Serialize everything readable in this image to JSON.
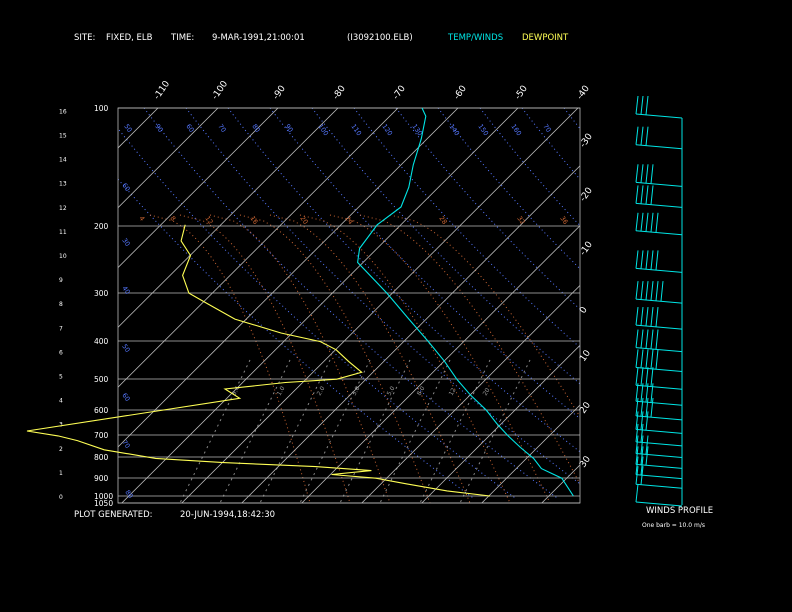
{
  "header": {
    "site_label": "SITE:",
    "site_value": "FIXED, ELB",
    "time_label": "TIME:",
    "time_value": "9-MAR-1991,21:00:01",
    "file_name": "(I3092100.ELB)",
    "legend_temp": "TEMP/WINDS",
    "legend_dew": "DEWPOINT"
  },
  "footer": {
    "generated_label": "PLOT GENERATED:",
    "generated_value": "20-JUN-1994,18:42:30",
    "winds_title": "WINDS PROFILE",
    "barb_note": "One barb = 10.0 m/s"
  },
  "colors": {
    "background": "#000000",
    "temp": "#00e5e5",
    "dew": "#ffff55",
    "grid": "#bbbbbb",
    "dry_adiabat": "#5577ff",
    "moist_adiabat": "#cc6633",
    "text": "#ffffff"
  },
  "chart_data": {
    "type": "line",
    "pressure_levels": [
      100,
      200,
      300,
      400,
      500,
      600,
      700,
      800,
      900,
      1000,
      1050
    ],
    "altitude_ticks_km": [
      0,
      1,
      2,
      3,
      4,
      5,
      6,
      7,
      8,
      9,
      10,
      11,
      12,
      13,
      14,
      15,
      16
    ],
    "isotherm_labels": [
      -110,
      -100,
      -90,
      -80,
      -70,
      -60,
      -50,
      -40,
      -30,
      -20,
      -10,
      0,
      10,
      20,
      30
    ],
    "dry_adiabat_labels": [
      "50",
      "90",
      "60",
      "70",
      "80",
      "90",
      "100",
      "110",
      "120",
      "130",
      "140",
      "150",
      "160",
      "70",
      "60",
      "30",
      "40",
      "50",
      "60",
      "70",
      "80",
      "90",
      "100"
    ],
    "moist_adiabat_labels": [
      "4",
      "8",
      "12",
      "16",
      "20",
      "24",
      "28",
      "32",
      "36"
    ],
    "mixing_ratio_labels": [
      "0.4",
      "1.0",
      "2.0",
      "3.0",
      "5.0",
      "8.0",
      "12",
      "20"
    ],
    "series": [
      {
        "name": "TEMP/WINDS",
        "points": [
          [
            1000,
            23.9
          ],
          [
            960,
            22
          ],
          [
            900,
            19
          ],
          [
            850,
            14
          ],
          [
            800,
            11
          ],
          [
            750,
            7
          ],
          [
            700,
            3
          ],
          [
            650,
            -1
          ],
          [
            600,
            -5
          ],
          [
            550,
            -10
          ],
          [
            500,
            -15
          ],
          [
            450,
            -20
          ],
          [
            400,
            -26
          ],
          [
            350,
            -33
          ],
          [
            300,
            -41
          ],
          [
            250,
            -51
          ],
          [
            230,
            -53
          ],
          [
            200,
            -54
          ],
          [
            180,
            -53
          ],
          [
            160,
            -55
          ],
          [
            140,
            -58
          ],
          [
            120,
            -61
          ],
          [
            105,
            -64
          ],
          [
            100,
            -66
          ]
        ]
      },
      {
        "name": "DEWPOINT",
        "points": [
          [
            1000,
            10
          ],
          [
            970,
            2
          ],
          [
            930,
            -6
          ],
          [
            900,
            -12
          ],
          [
            880,
            -20
          ],
          [
            860,
            -14
          ],
          [
            840,
            -24
          ],
          [
            820,
            -40
          ],
          [
            800,
            -52
          ],
          [
            760,
            -62
          ],
          [
            720,
            -68
          ],
          [
            700,
            -72
          ],
          [
            680,
            -78
          ],
          [
            560,
            -48
          ],
          [
            530,
            -52
          ],
          [
            510,
            -43
          ],
          [
            500,
            -35
          ],
          [
            480,
            -32
          ],
          [
            450,
            -36
          ],
          [
            420,
            -40
          ],
          [
            400,
            -44
          ],
          [
            380,
            -52
          ],
          [
            350,
            -62
          ],
          [
            320,
            -69
          ],
          [
            300,
            -74
          ],
          [
            270,
            -78
          ],
          [
            240,
            -80
          ],
          [
            220,
            -84
          ],
          [
            200,
            -86
          ]
        ]
      }
    ],
    "winds": [
      {
        "p": 1000,
        "dir": 180,
        "spd": 5
      },
      {
        "p": 900,
        "dir": 220,
        "spd": 15
      },
      {
        "p": 850,
        "dir": 240,
        "spd": 22
      },
      {
        "p": 800,
        "dir": 250,
        "spd": 25
      },
      {
        "p": 750,
        "dir": 260,
        "spd": 26
      },
      {
        "p": 700,
        "dir": 260,
        "spd": 24
      },
      {
        "p": 650,
        "dir": 265,
        "spd": 30
      },
      {
        "p": 600,
        "dir": 265,
        "spd": 38
      },
      {
        "p": 550,
        "dir": 270,
        "spd": 42
      },
      {
        "p": 500,
        "dir": 270,
        "spd": 44
      },
      {
        "p": 450,
        "dir": 270,
        "spd": 46
      },
      {
        "p": 400,
        "dir": 270,
        "spd": 48
      },
      {
        "p": 350,
        "dir": 275,
        "spd": 50
      },
      {
        "p": 300,
        "dir": 275,
        "spd": 55
      },
      {
        "p": 250,
        "dir": 275,
        "spd": 50
      },
      {
        "p": 200,
        "dir": 275,
        "spd": 45
      },
      {
        "p": 170,
        "dir": 280,
        "spd": 40
      },
      {
        "p": 150,
        "dir": 280,
        "spd": 35
      },
      {
        "p": 120,
        "dir": 290,
        "spd": 30
      },
      {
        "p": 100,
        "dir": 290,
        "spd": 28
      }
    ]
  }
}
